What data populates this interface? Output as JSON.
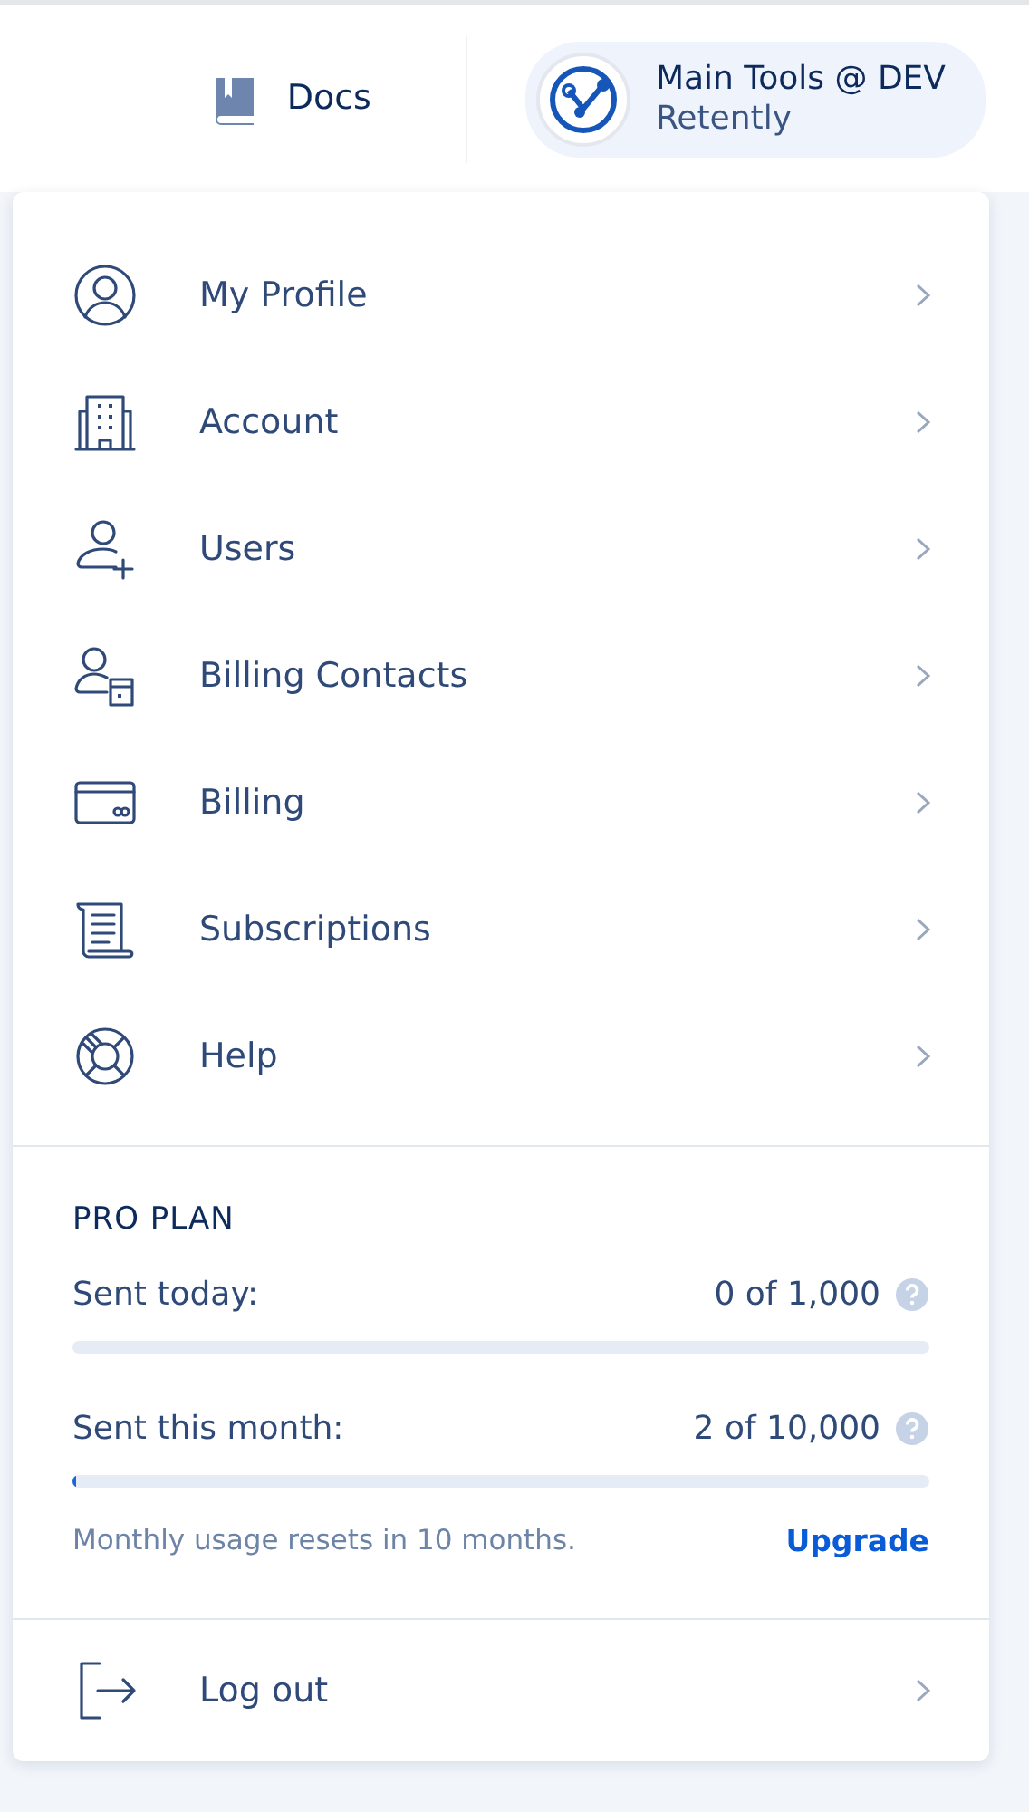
{
  "header": {
    "docs_link": "Docs",
    "workspace": {
      "name": "Main Tools @ DEV",
      "company": "Retently"
    }
  },
  "menu": {
    "items": [
      {
        "label": "My Profile"
      },
      {
        "label": "Account"
      },
      {
        "label": "Users"
      },
      {
        "label": "Billing Contacts"
      },
      {
        "label": "Billing"
      },
      {
        "label": "Subscriptions"
      },
      {
        "label": "Help"
      }
    ],
    "plan": {
      "title": "PRO PLAN",
      "usage": [
        {
          "label": "Sent today:",
          "reading": "0 of 1,000",
          "level": 0
        },
        {
          "label": "Sent this month:",
          "reading": "2 of 10,000",
          "level": 0.0002
        }
      ],
      "note": "Monthly usage resets in 10 months.",
      "upgrade": "Upgrade"
    },
    "logout": {
      "label": "Log out"
    }
  }
}
